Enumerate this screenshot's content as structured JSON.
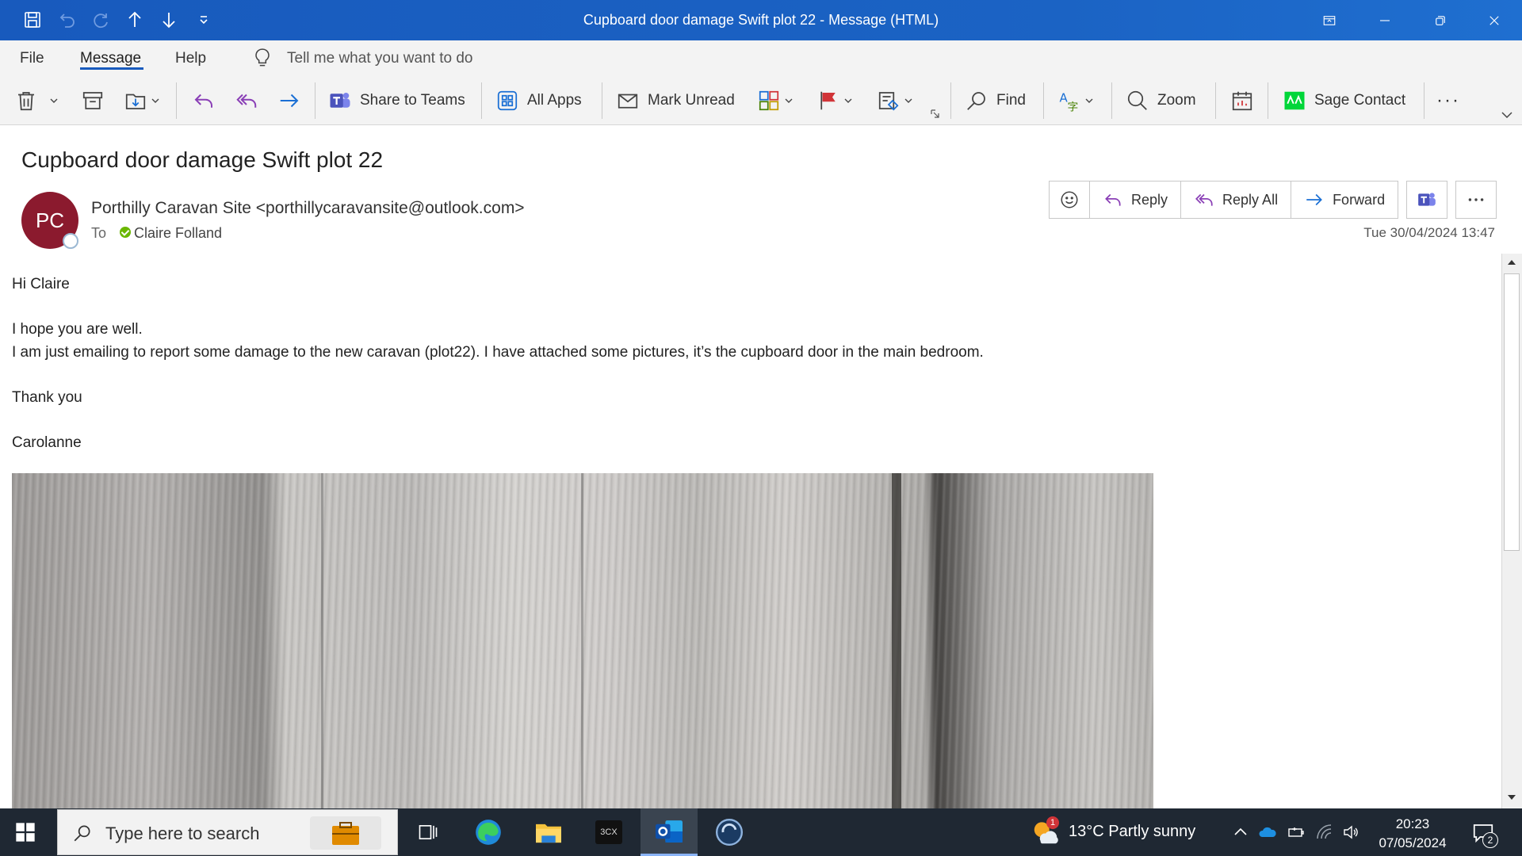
{
  "window": {
    "title": "Cupboard door damage Swift plot 22  -  Message (HTML)"
  },
  "menu": {
    "file": "File",
    "message": "Message",
    "help": "Help",
    "tell_me": "Tell me what you want to do"
  },
  "ribbon": {
    "share_teams": "Share to Teams",
    "all_apps": "All Apps",
    "mark_unread": "Mark Unread",
    "find": "Find",
    "zoom": "Zoom",
    "sage_contact": "Sage Contact",
    "more": "···"
  },
  "message": {
    "subject": "Cupboard door damage Swift plot 22",
    "avatar_initials": "PC",
    "sender": "Porthilly Caravan Site <porthillycaravansite@outlook.com>",
    "to_label": "To",
    "to_name": "Claire Folland",
    "date": "Tue 30/04/2024 13:47",
    "actions": {
      "reply": "Reply",
      "reply_all": "Reply All",
      "forward": "Forward"
    },
    "body": {
      "greeting": "Hi Claire",
      "line1": "I hope you are well.",
      "line2": "I am just emailing to report some damage to the new caravan (plot22). I have attached some pictures, it’s the cupboard door in the main bedroom.",
      "thanks": "Thank you",
      "signature": "Carolanne"
    }
  },
  "taskbar": {
    "search_placeholder": "Type here to search",
    "weather": "13°C  Partly sunny",
    "weather_badge": "1",
    "time": "20:23",
    "date": "07/05/2024",
    "notification_count": "2",
    "app_3cx": "3CX"
  },
  "colors": {
    "titlebar": "#185abd",
    "accent": "#185abd",
    "avatar": "#8b1a2e",
    "presence_available": "#6bb700",
    "taskbar": "#1f2833"
  }
}
